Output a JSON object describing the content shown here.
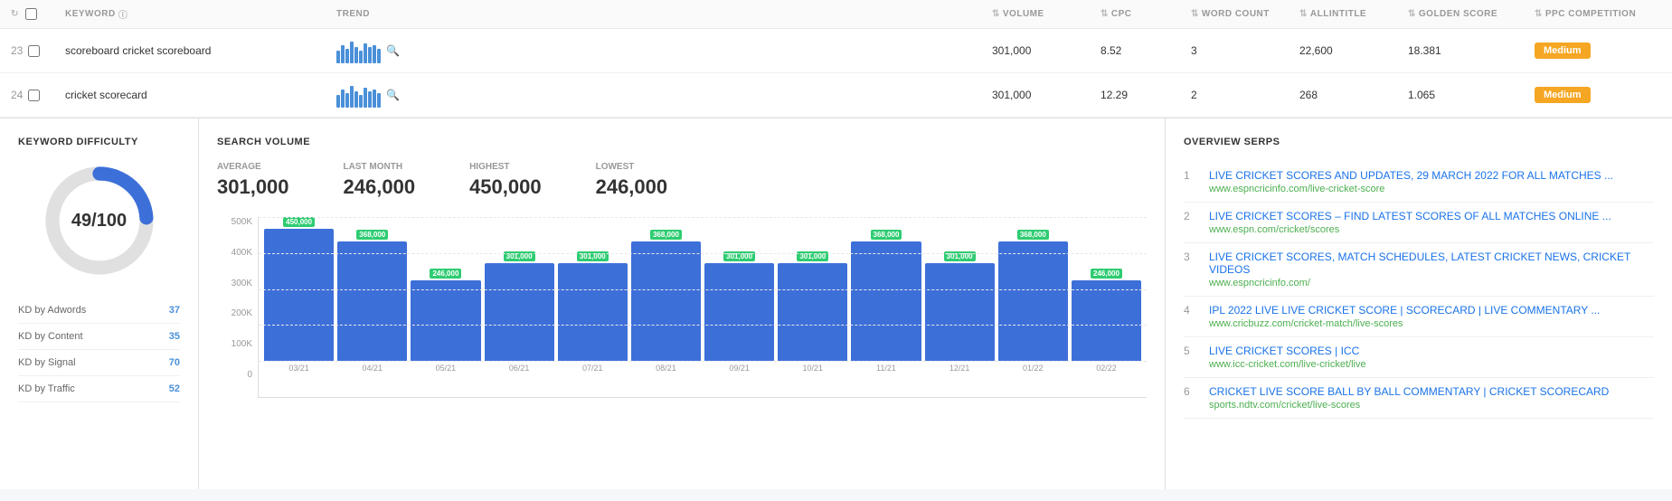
{
  "table": {
    "headers": [
      {
        "id": "num",
        "label": ""
      },
      {
        "id": "keyword",
        "label": "KEYWORD"
      },
      {
        "id": "trend",
        "label": "TREND"
      },
      {
        "id": "volume",
        "label": "VOLUME"
      },
      {
        "id": "cpc",
        "label": "CPC"
      },
      {
        "id": "word_count",
        "label": "WORD COUNT"
      },
      {
        "id": "allintitle",
        "label": "ALLINTITLE"
      },
      {
        "id": "golden_score",
        "label": "GOLDEN SCORE"
      },
      {
        "id": "ppc",
        "label": "PPC COMPETITION"
      }
    ],
    "rows": [
      {
        "num": "23",
        "keyword": "scoreboard cricket scoreboard",
        "volume": "301,000",
        "cpc": "8.52",
        "word_count": "3",
        "allintitle": "22,600",
        "golden_score": "18.381",
        "ppc": "Medium",
        "trend_heights": [
          14,
          18,
          22,
          16,
          20,
          24,
          18,
          14,
          22,
          18
        ]
      },
      {
        "num": "24",
        "keyword": "cricket scorecard",
        "volume": "301,000",
        "cpc": "12.29",
        "word_count": "2",
        "allintitle": "268",
        "golden_score": "1.065",
        "ppc": "Medium",
        "trend_heights": [
          14,
          18,
          22,
          16,
          20,
          24,
          18,
          14,
          22,
          18
        ]
      }
    ]
  },
  "kd_panel": {
    "title": "KEYWORD DIFFICULTY",
    "score": "49/100",
    "donut_value": 49,
    "metrics": [
      {
        "label": "KD by Adwords",
        "value": "37"
      },
      {
        "label": "KD by Content",
        "value": "35"
      },
      {
        "label": "KD by Signal",
        "value": "70"
      },
      {
        "label": "KD by Traffic",
        "value": "52"
      }
    ]
  },
  "sv_panel": {
    "title": "SEARCH VOLUME",
    "stats": [
      {
        "label": "AVERAGE",
        "value": "301,000"
      },
      {
        "label": "LAST MONTH",
        "value": "246,000"
      },
      {
        "label": "HIGHEST",
        "value": "450,000"
      },
      {
        "label": "LOWEST",
        "value": "246,000"
      }
    ],
    "chart": {
      "y_labels": [
        "500K",
        "400K",
        "300K",
        "200K",
        "100K",
        "0"
      ],
      "bars": [
        {
          "month": "03/21",
          "value": 450000,
          "label": "450,000",
          "height_pct": 90
        },
        {
          "month": "04/21",
          "value": 368000,
          "label": "368,000",
          "height_pct": 73.6
        },
        {
          "month": "05/21",
          "value": 246000,
          "label": "246,000",
          "height_pct": 49.2
        },
        {
          "month": "06/21",
          "value": 301000,
          "label": "301,000",
          "height_pct": 60.2
        },
        {
          "month": "07/21",
          "value": 301000,
          "label": "301,000",
          "height_pct": 60.2
        },
        {
          "month": "08/21",
          "value": 368000,
          "label": "368,000",
          "height_pct": 73.6
        },
        {
          "month": "09/21",
          "value": 301000,
          "label": "301,000",
          "height_pct": 60.2
        },
        {
          "month": "10/21",
          "value": 301000,
          "label": "301,000",
          "height_pct": 60.2
        },
        {
          "month": "11/21",
          "value": 368000,
          "label": "368,000",
          "height_pct": 73.6
        },
        {
          "month": "12/21",
          "value": 301000,
          "label": "301,000",
          "height_pct": 60.2
        },
        {
          "month": "01/22",
          "value": 368000,
          "label": "368,000",
          "height_pct": 73.6
        },
        {
          "month": "02/22",
          "value": 246000,
          "label": "246,000",
          "height_pct": 49.2
        }
      ]
    }
  },
  "serps_panel": {
    "title": "OVERVIEW SERPS",
    "items": [
      {
        "num": "1",
        "title": "LIVE CRICKET SCORES AND UPDATES, 29 MARCH 2022 FOR ALL MATCHES ...",
        "url": "www.espncricinfo.com/live-cricket-score"
      },
      {
        "num": "2",
        "title": "LIVE CRICKET SCORES – FIND LATEST SCORES OF ALL MATCHES ONLINE ...",
        "url": "www.espn.com/cricket/scores"
      },
      {
        "num": "3",
        "title": "LIVE CRICKET SCORES, MATCH SCHEDULES, LATEST CRICKET NEWS, CRICKET VIDEOS",
        "url": "www.espncricinfo.com/"
      },
      {
        "num": "4",
        "title": "IPL 2022 LIVE LIVE CRICKET SCORE | SCORECARD | LIVE COMMENTARY ...",
        "url": "www.cricbuzz.com/cricket-match/live-scores"
      },
      {
        "num": "5",
        "title": "LIVE CRICKET SCORES | ICC",
        "url": "www.icc-cricket.com/live-cricket/live"
      },
      {
        "num": "6",
        "title": "CRICKET LIVE SCORE BALL BY BALL COMMENTARY | CRICKET SCORECARD",
        "url": "sports.ndtv.com/cricket/live-scores"
      }
    ]
  },
  "colors": {
    "bar_blue": "#3d6fd9",
    "label_green": "#2ecc71",
    "badge_orange": "#f5a623",
    "link_blue": "#1a73e8",
    "url_green": "#4caf50",
    "donut_blue": "#3d6fd9",
    "donut_gray": "#e0e0e0"
  }
}
